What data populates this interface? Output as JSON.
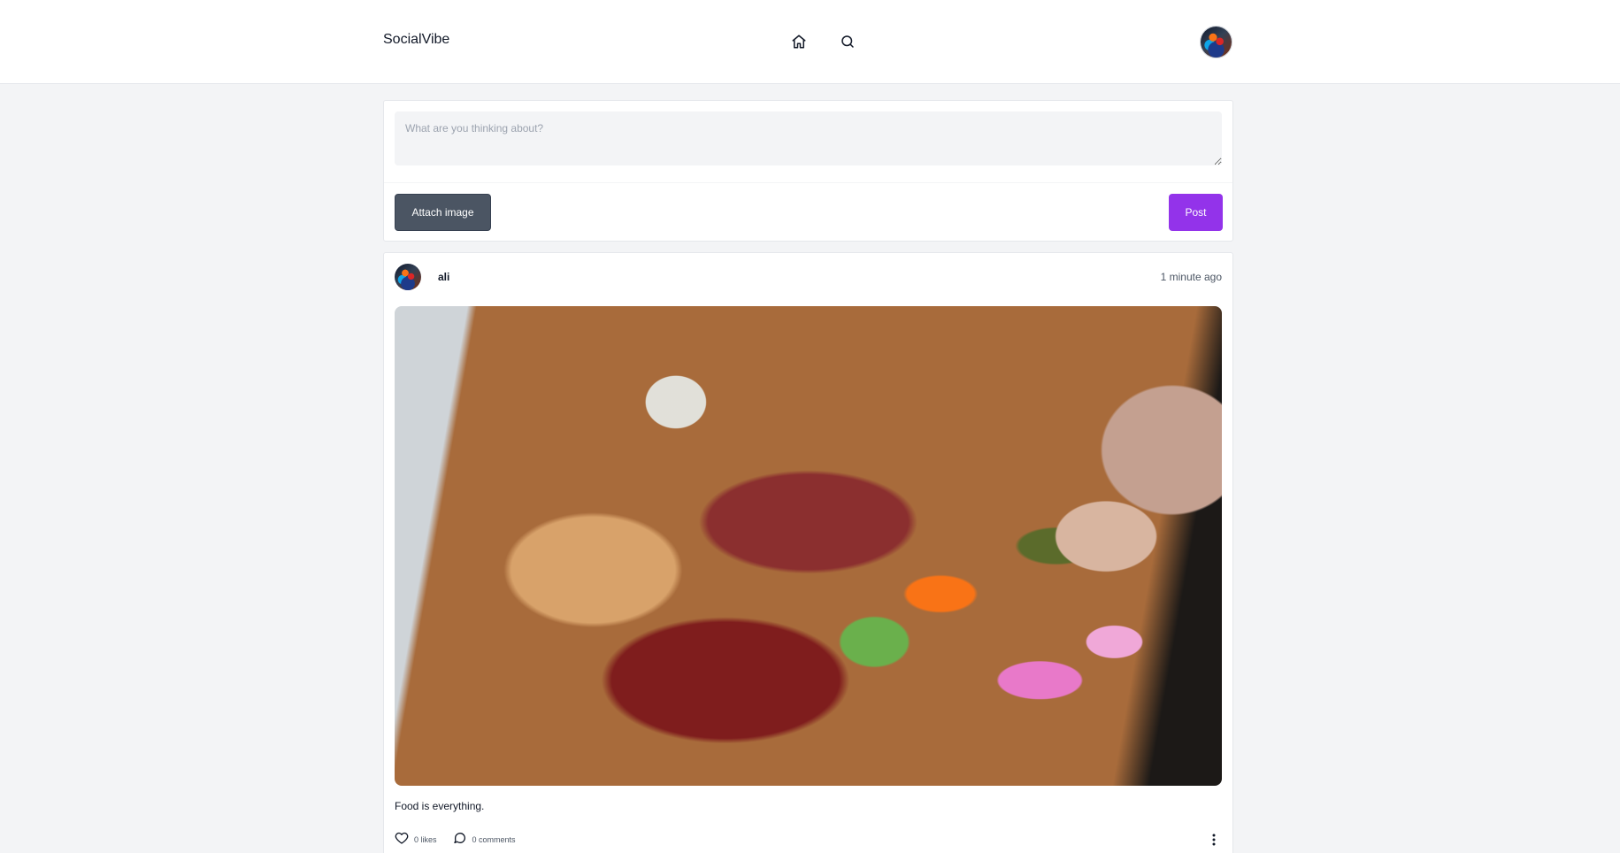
{
  "app": {
    "name": "SocialVibe"
  },
  "nav": {
    "home_icon": "home-icon",
    "search_icon": "search-icon",
    "avatar_icon": "user-avatar"
  },
  "composer": {
    "placeholder": "What are you thinking about?",
    "value": "",
    "attach_label": "Attach image",
    "post_label": "Post"
  },
  "posts": [
    {
      "author": "ali",
      "time": "1 minute ago",
      "text": "Food is everything.",
      "likes_label": "0 likes",
      "comments_label": "0 comments",
      "icons": {
        "like": "heart-icon",
        "comment": "comment-icon",
        "more": "more-vertical-icon"
      }
    }
  ],
  "colors": {
    "primary": "#9333ea",
    "secondary_button": "#4b5563",
    "page_bg": "#f3f4f6",
    "card_bg": "#ffffff"
  }
}
